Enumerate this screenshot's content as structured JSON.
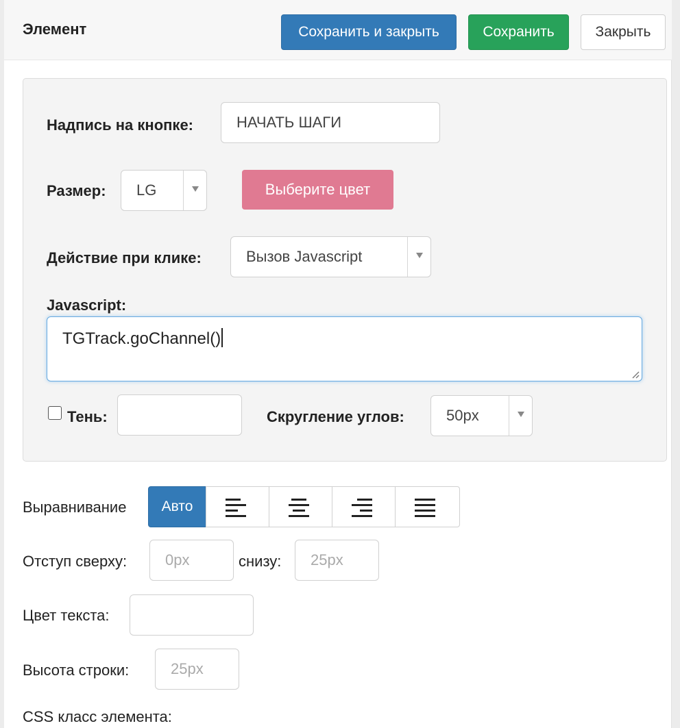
{
  "header": {
    "title": "Элемент",
    "save_close_label": "Сохранить и закрыть",
    "save_label": "Сохранить",
    "close_label": "Закрыть"
  },
  "form": {
    "button_text_label": "Надпись на кнопке:",
    "button_text_value": "НАЧАТЬ ШАГИ",
    "size_label": "Размер:",
    "size_value": "LG",
    "color_button_label": "Выберите цвет",
    "action_label": "Действие при клике:",
    "action_value": "Вызов Javascript",
    "javascript_label": "Javascript:",
    "javascript_value": "TGTrack.goChannel()",
    "shadow_label": "Тень:",
    "shadow_checked": false,
    "shadow_value": "",
    "radius_label": "Скругление углов:",
    "radius_value": "50px"
  },
  "layout_settings": {
    "alignment_label": "Выравнивание",
    "alignment_options": [
      "Авто",
      "align-left-icon",
      "align-center-icon",
      "align-right-icon",
      "align-justify-icon"
    ],
    "alignment_selected": "Авто",
    "margin_top_label": "Отступ сверху:",
    "margin_top_placeholder": "0px",
    "margin_bottom_label": "снизу:",
    "margin_bottom_placeholder": "25px",
    "text_color_label": "Цвет текста:",
    "text_color_value": "",
    "line_height_label": "Высота строки:",
    "line_height_placeholder": "25px",
    "css_class_label": "CSS класс элемента:"
  },
  "colors": {
    "primary": "#337ab7",
    "success": "#28a25a",
    "pink": "#e07a92"
  }
}
